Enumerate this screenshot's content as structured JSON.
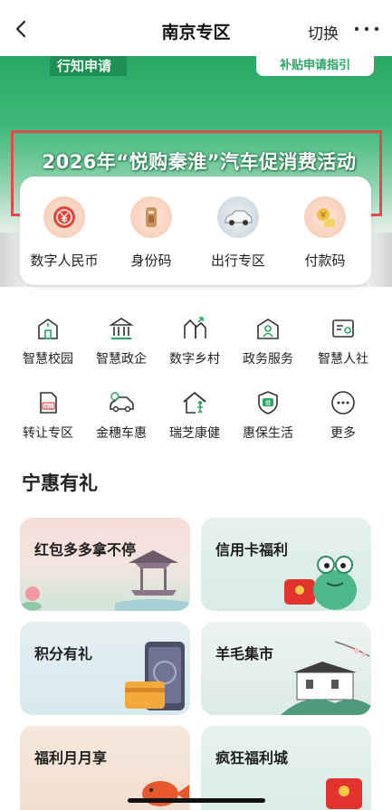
{
  "header": {
    "title": "南京专区",
    "switch_label": "切换"
  },
  "banner": {
    "title": "2026年“悦购秦淮”汽车促消费活动",
    "sign_left": "行知申请",
    "sign_right": "补贴申请指引"
  },
  "quick_actions": [
    {
      "label": "数字人民币",
      "icon": "digital-rmb-icon"
    },
    {
      "label": "身份码",
      "icon": "id-code-icon"
    },
    {
      "label": "出行专区",
      "icon": "car-icon"
    },
    {
      "label": "付款码",
      "icon": "payment-code-icon"
    }
  ],
  "services": [
    {
      "label": "智慧校园",
      "icon": "school-icon"
    },
    {
      "label": "智慧政企",
      "icon": "government-building-icon"
    },
    {
      "label": "数字乡村",
      "icon": "village-icon"
    },
    {
      "label": "政务服务",
      "icon": "service-hall-icon"
    },
    {
      "label": "智慧人社",
      "icon": "id-card-icon"
    },
    {
      "label": "转让专区",
      "icon": "transfer-doc-icon"
    },
    {
      "label": "金穗车惠",
      "icon": "car-coin-icon"
    },
    {
      "label": "瑞芝康健",
      "icon": "health-home-icon"
    },
    {
      "label": "惠保生活",
      "icon": "shield-health-icon"
    },
    {
      "label": "更多",
      "icon": "more-icon"
    }
  ],
  "section": {
    "title": "宁惠有礼"
  },
  "promos": [
    {
      "title": "红包多多拿不停"
    },
    {
      "title": "信用卡福利"
    },
    {
      "title": "积分有礼"
    },
    {
      "title": "羊毛集市"
    },
    {
      "title": "福利月月享"
    },
    {
      "title": "疯狂福利城"
    }
  ],
  "colors": {
    "brand_green": "#2aa765",
    "highlight_red": "#e14a4a"
  }
}
